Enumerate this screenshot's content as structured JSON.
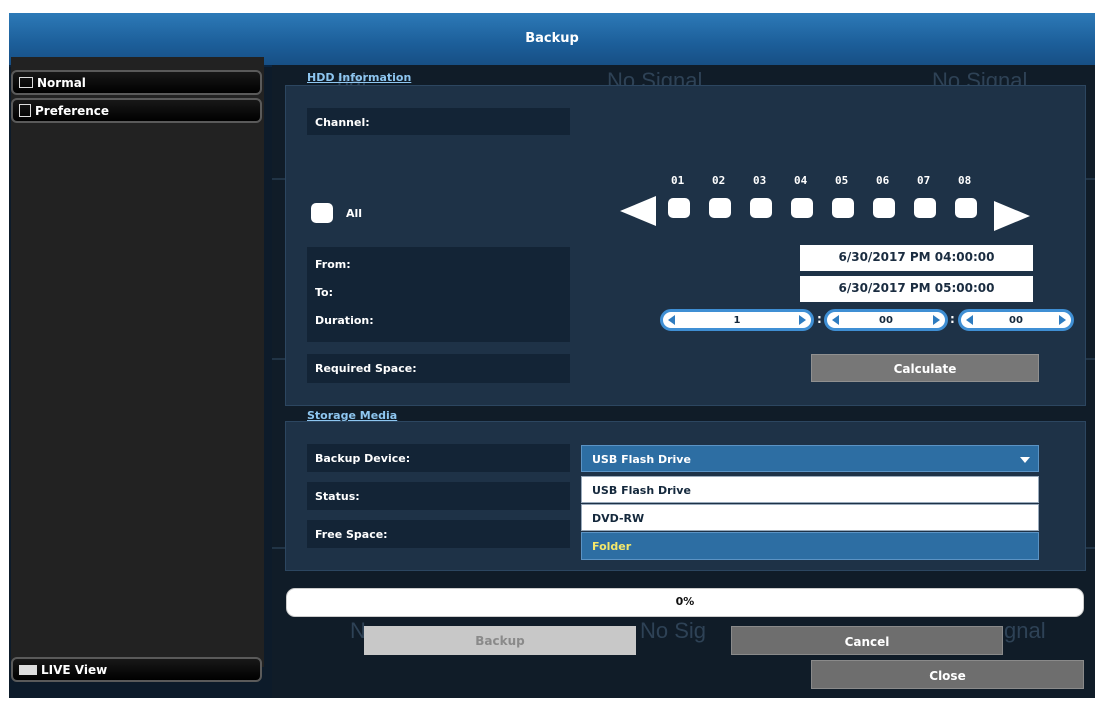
{
  "window": {
    "title": "Backup"
  },
  "sidebar": {
    "items": [
      {
        "label": "Normal",
        "icon": "folder-icon"
      },
      {
        "label": "Preference",
        "icon": "clipboard-icon"
      }
    ],
    "live_view": {
      "label": "LIVE View",
      "icon": "camera-icon"
    }
  },
  "background": {
    "no_signal": "No Signal",
    "no_sig": "No Sig",
    "gnal": "gnal",
    "N": "N",
    "nal": "nal"
  },
  "hdd": {
    "section_title": "HDD Information",
    "channel_label": "Channel:",
    "channels": [
      "01",
      "02",
      "03",
      "04",
      "05",
      "06",
      "07",
      "08"
    ],
    "all_label": "All",
    "from_label": "From:",
    "to_label": "To:",
    "duration_label": "Duration:",
    "from_value": "6/30/2017 PM 04:00:00",
    "to_value": "6/30/2017 PM 05:00:00",
    "duration": {
      "hours": "1",
      "minutes": "00",
      "seconds": "00",
      "separator": ":"
    },
    "required_space_label": "Required Space:",
    "calculate_label": "Calculate"
  },
  "storage": {
    "section_title": "Storage Media",
    "backup_device_label": "Backup Device:",
    "selected_device": "USB Flash Drive",
    "options": [
      "USB Flash Drive",
      "DVD-RW",
      "Folder"
    ],
    "highlighted_option": "Folder",
    "status_label": "Status:",
    "free_space_label": "Free Space:"
  },
  "progress": {
    "percent": 0,
    "text": "0%"
  },
  "buttons": {
    "backup": "Backup",
    "cancel": "Cancel",
    "close": "Close"
  },
  "colors": {
    "accent": "#3f8fd4",
    "highlight_text": "#f5e86a",
    "panel": "#1e3247"
  }
}
